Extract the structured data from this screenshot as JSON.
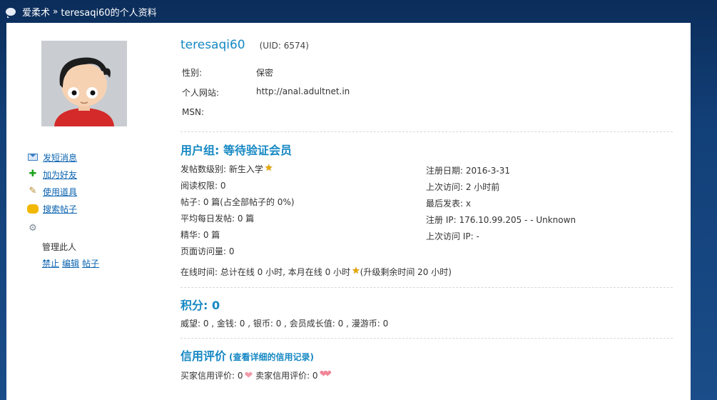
{
  "breadcrumb": {
    "home": "爱柔术",
    "separator": "»",
    "current": "teresaqi60的个人资料"
  },
  "profile": {
    "username": "teresaqi60",
    "uid": "(UID: 6574)",
    "fields": [
      {
        "label": "性别:",
        "value": "保密"
      },
      {
        "label": "个人网站:",
        "value": "http://anal.adultnet.in"
      },
      {
        "label": "MSN:",
        "value": ""
      }
    ]
  },
  "sidebar": {
    "actions": [
      {
        "label": "发短消息",
        "icon": "mail-icon"
      },
      {
        "label": "加为好友",
        "icon": "plus-icon"
      },
      {
        "label": "使用道具",
        "icon": "wand-icon"
      },
      {
        "label": "搜索帖子",
        "icon": "search-icon"
      }
    ],
    "admin_title": "管理此人",
    "admin_links": [
      "禁止",
      "编辑",
      "帖子"
    ]
  },
  "usergroup": {
    "title": "用户组: 等待验证会员",
    "left": [
      "发帖数级别: 新生入学",
      "阅读权限: 0",
      "帖子: 0 篇(占全部帖子的 0%)",
      "平均每日发帖: 0 篇",
      "精华: 0 篇",
      "页面访问量: 0"
    ],
    "right": [
      "注册日期: 2016-3-31",
      "上次访问: 2 小时前",
      "最后发表: x",
      "注册 IP: 176.10.99.205 - - Unknown",
      "上次访问 IP: -"
    ],
    "online_text": "在线时间: 总计在线 0 小时, 本月在线 0 小时",
    "online_suffix": "(升级剩余时间 20 小时)"
  },
  "points": {
    "title": "积分: 0",
    "detail": "威望: 0 , 金钱: 0 , 银币: 0 , 会员成长值: 0 , 漫游币: 0"
  },
  "credit": {
    "title": "信用评价",
    "link": "(查看详细的信用记录)",
    "buyer": "买家信用评价: 0",
    "seller": "卖家信用评价: 0"
  },
  "colors": {
    "accent": "#1688c3",
    "link": "#0a63b0",
    "header_bg": "#0b2d5a"
  }
}
